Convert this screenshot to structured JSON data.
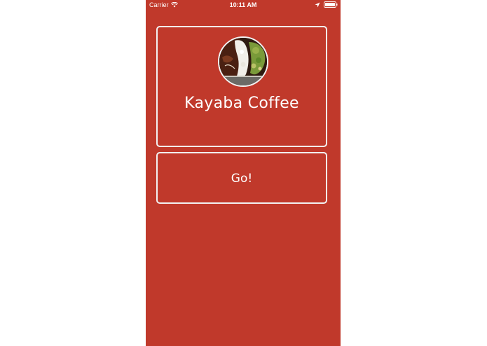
{
  "status_bar": {
    "carrier": "Carrier",
    "time": "10:11 AM",
    "icons": [
      "wifi-icon",
      "location-icon",
      "battery-icon"
    ]
  },
  "profile": {
    "name": "Kayaba Coffee",
    "avatar": "food-photo-avatar"
  },
  "go_button": {
    "label": "Go!"
  },
  "colors": {
    "background": "#c0392b",
    "border": "#f2f2f2",
    "text": "#ffffff"
  }
}
